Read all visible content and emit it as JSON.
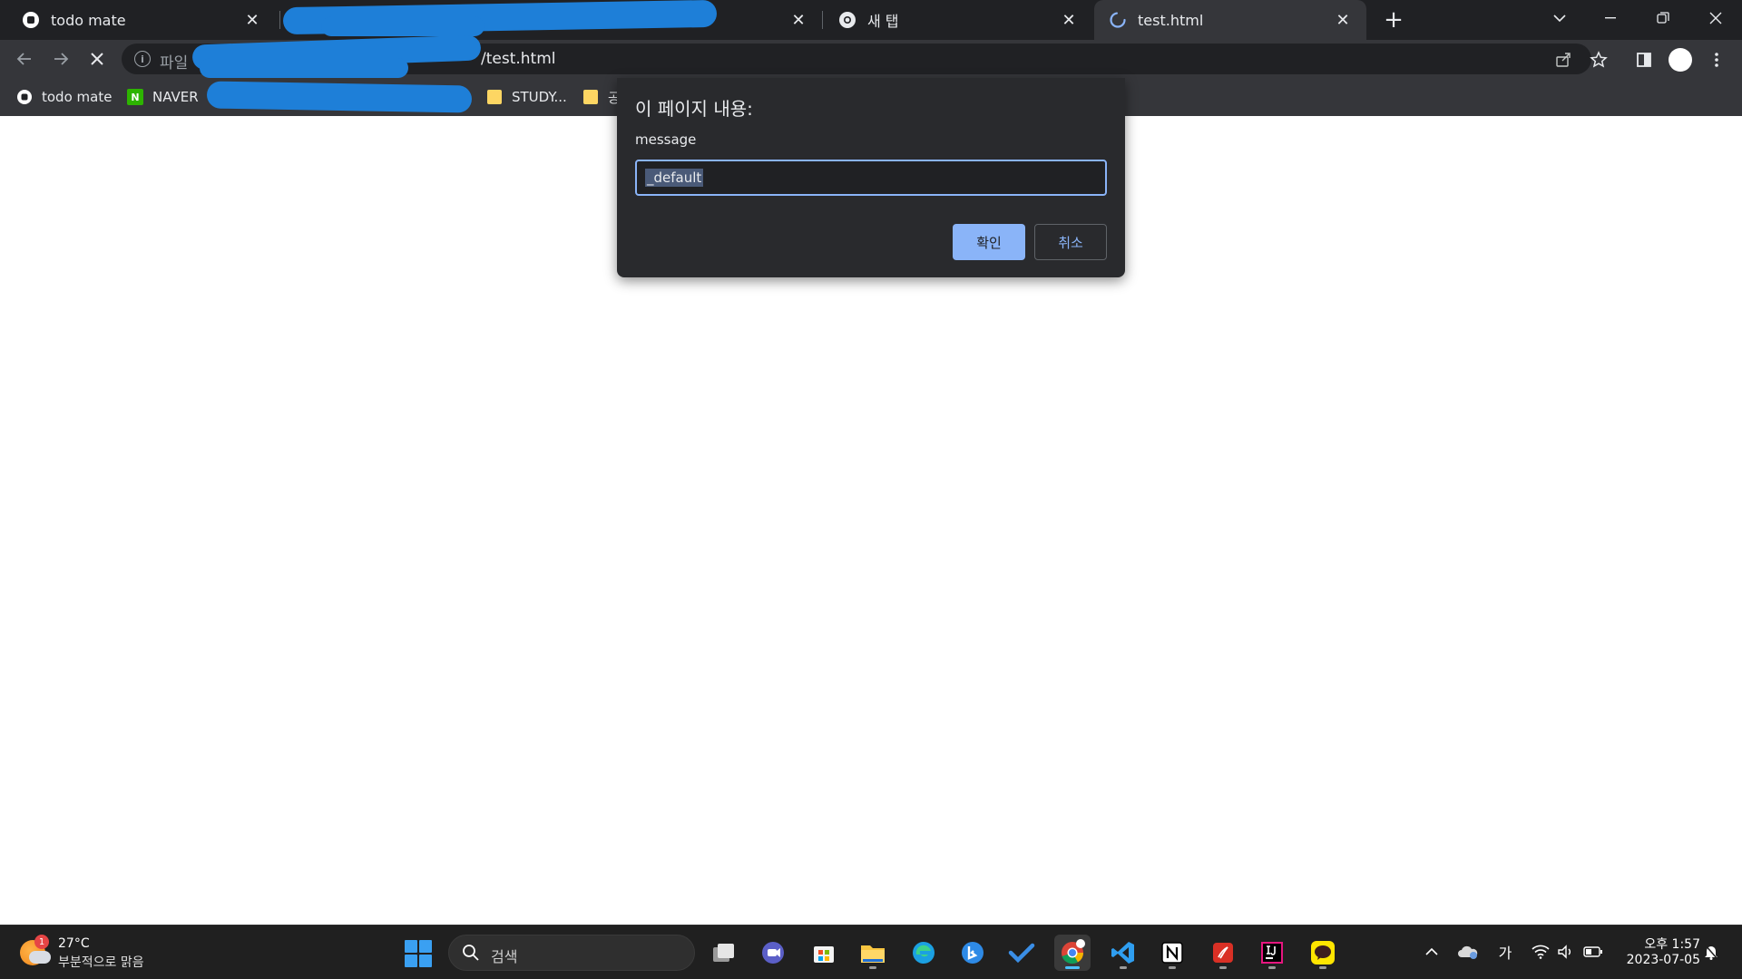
{
  "browser": {
    "tabs": [
      {
        "label": "todo mate",
        "icon": "todo-mate-icon",
        "active": false
      },
      {
        "label": "",
        "icon": "page-icon",
        "active": false,
        "redacted": true
      },
      {
        "label": "새 탭",
        "icon": "chrome-icon",
        "active": false
      },
      {
        "label": "test.html",
        "icon": "loading-spinner-icon",
        "active": true
      }
    ],
    "new_tab": "+",
    "close_glyph": "✕",
    "omnibox": {
      "scheme": "파일",
      "path": "/test.html"
    },
    "bookmarks": [
      {
        "label": "todo mate",
        "icon": "todo-mate-icon"
      },
      {
        "label": "NAVER",
        "icon": "naver-icon",
        "icon_text": "N"
      },
      {
        "label": "STUDY...",
        "icon": "folder-icon"
      },
      {
        "label": "공",
        "icon": "folder-icon"
      }
    ]
  },
  "dialog": {
    "title": "이 페이지 내용:",
    "message": "message",
    "input_value": "_default",
    "ok_label": "확인",
    "cancel_label": "취소"
  },
  "taskbar": {
    "weather": {
      "badge": "1",
      "temperature": "27°C",
      "condition": "부분적으로 맑음"
    },
    "search_placeholder": "검색",
    "ime": "가",
    "time": "오후 1:57",
    "date": "2023-07-05"
  },
  "colors": {
    "accent": "#8ab4f8",
    "dialog_bg": "#292a2d",
    "chrome_dark": "#202124",
    "toolbar": "#35363a",
    "redaction": "#1e7fd8"
  }
}
